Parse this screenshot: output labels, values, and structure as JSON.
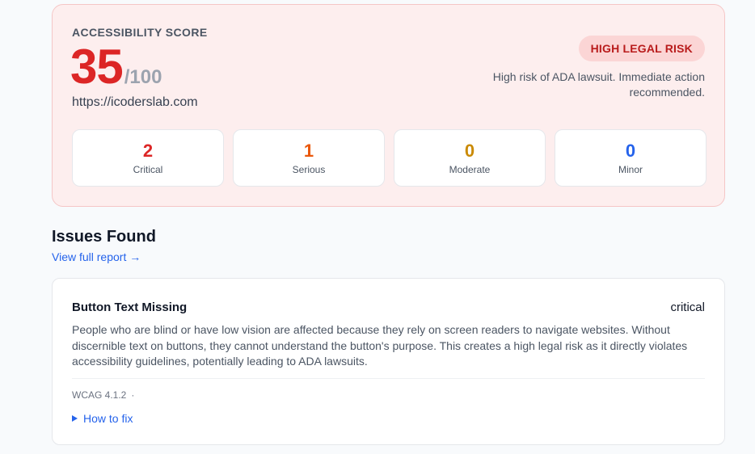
{
  "score_card": {
    "label": "ACCESSIBILITY SCORE",
    "score": "35",
    "max": "/100",
    "url": "https://icoderslab.com",
    "risk_badge": "HIGH LEGAL RISK",
    "risk_description": "High risk of ADA lawsuit. Immediate action recommended.",
    "colors": {
      "card_bg": "#fdeeee",
      "score": "#dc2626",
      "badge_bg": "#fbd5d5",
      "badge_text": "#b91c1c"
    },
    "counts": [
      {
        "value": "2",
        "label": "Critical",
        "color": "#dc2626"
      },
      {
        "value": "1",
        "label": "Serious",
        "color": "#ea580c"
      },
      {
        "value": "0",
        "label": "Moderate",
        "color": "#ca8a04"
      },
      {
        "value": "0",
        "label": "Minor",
        "color": "#2563eb"
      }
    ]
  },
  "issues": {
    "title": "Issues Found",
    "report_link": "View full report →",
    "items": [
      {
        "title": "Button Text Missing",
        "severity": "critical",
        "description": "People who are blind or have low vision are affected because they rely on screen readers to navigate websites. Without discernible text on buttons, they cannot understand the button's purpose. This creates a high legal risk as it directly violates accessibility guidelines, potentially leading to ADA lawsuits.",
        "wcag": "WCAG 4.1.2",
        "separator": "·",
        "how_to_fix": "How to fix",
        "how_to_fix_icon": "triangle-right-icon"
      }
    ]
  }
}
